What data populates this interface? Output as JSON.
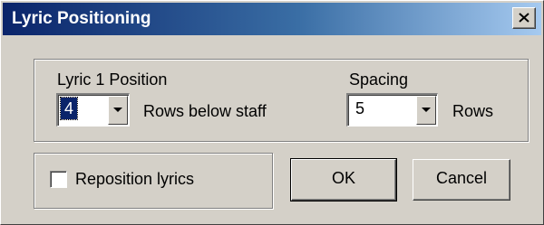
{
  "window": {
    "title": "Lyric Positioning",
    "close_icon": "close-icon"
  },
  "lyric_group": {
    "position_label": "Lyric 1 Position",
    "position_value": "4",
    "position_unit": "Rows below staff",
    "spacing_label": "Spacing",
    "spacing_value": "5",
    "spacing_unit": "Rows"
  },
  "options": {
    "reposition_label": "Reposition lyrics",
    "reposition_checked": false
  },
  "buttons": {
    "ok_label": "OK",
    "cancel_label": "Cancel"
  }
}
